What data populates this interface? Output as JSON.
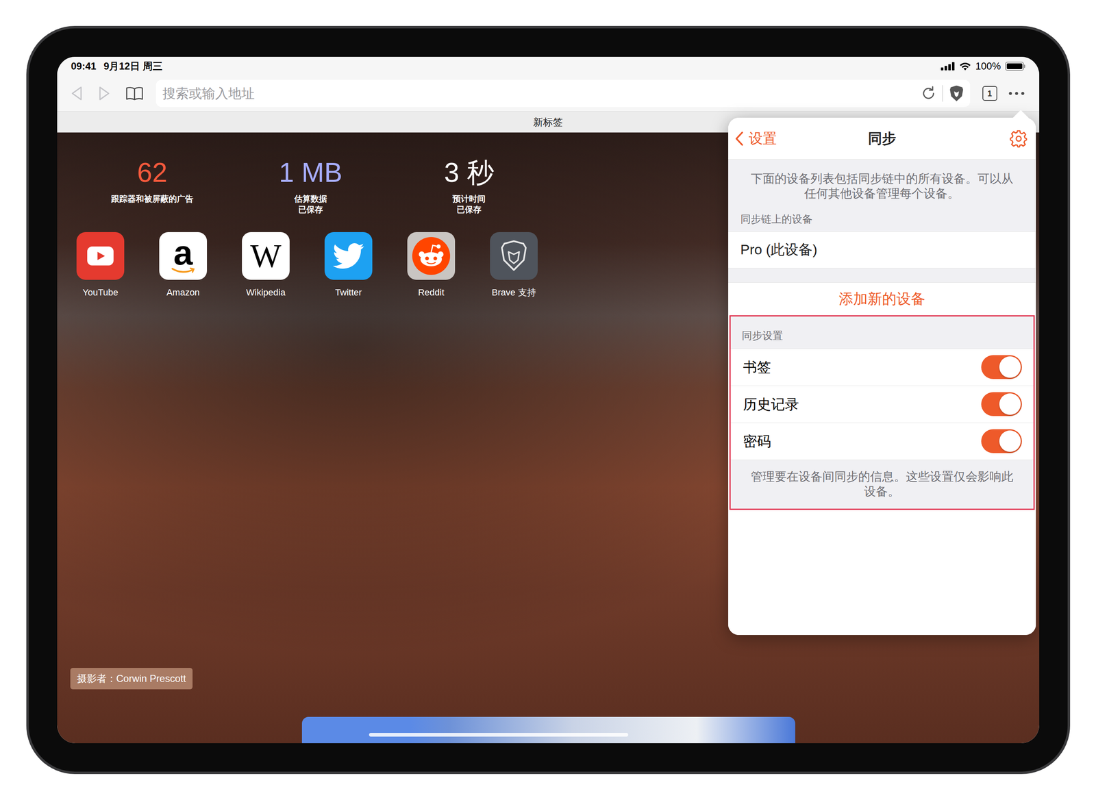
{
  "status_bar": {
    "time": "09:41",
    "date": "9月12日 周三",
    "battery": "100%",
    "battery_level": 1
  },
  "toolbar": {
    "back_enabled": false,
    "forward_enabled": false,
    "address_placeholder": "搜索或输入地址",
    "tab_count": "1"
  },
  "tab": {
    "title": "新标签"
  },
  "stats": [
    {
      "value": "62",
      "lines": [
        "跟踪器和被屏蔽的广告"
      ],
      "color": "#f4593c"
    },
    {
      "value": "1 MB",
      "lines": [
        "估算数据",
        "已保存"
      ],
      "color": "#a7adff"
    },
    {
      "value": "3 秒",
      "lines": [
        "预计时间",
        "已保存"
      ],
      "color": "#ffffff"
    }
  ],
  "favorites": [
    {
      "label": "YouTube",
      "kind": "youtube",
      "glyph": ""
    },
    {
      "label": "Amazon",
      "kind": "amazon",
      "glyph": "a"
    },
    {
      "label": "Wikipedia",
      "kind": "wikipedia",
      "glyph": "W"
    },
    {
      "label": "Twitter",
      "kind": "twitter",
      "glyph": ""
    },
    {
      "label": "Reddit",
      "kind": "reddit",
      "glyph": ""
    },
    {
      "label": "Brave 支持",
      "kind": "brave",
      "glyph": ""
    }
  ],
  "photo_credit": "摄影者：Corwin Prescott",
  "sync_panel": {
    "back": "设置",
    "title": "同步",
    "description": "下面的设备列表包括同步链中的所有设备。可以从任何其他设备管理每个设备。",
    "devices_header": "同步链上的设备",
    "devices": [
      {
        "name": "Pro (此设备)"
      }
    ],
    "add_device": "添加新的设备",
    "settings_header": "同步设置",
    "settings": [
      {
        "label": "书签",
        "on": true
      },
      {
        "label": "历史记录",
        "on": true
      },
      {
        "label": "密码",
        "on": true
      }
    ],
    "settings_footer": "管理要在设备间同步的信息。这些设置仅会影响此设备。"
  }
}
